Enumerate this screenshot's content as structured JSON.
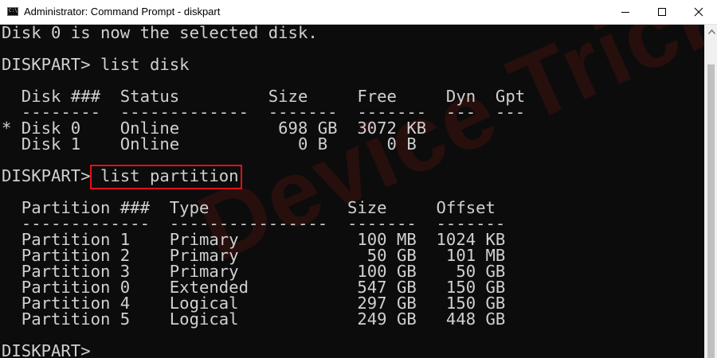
{
  "window": {
    "title": "Administrator: Command Prompt - diskpart",
    "icon_text": "C:\\",
    "icons": {
      "app": "command-prompt-icon",
      "minimize": "minimize-icon",
      "maximize": "maximize-icon",
      "close": "close-icon",
      "scroll_up": "scroll-up-arrow-icon"
    }
  },
  "console": {
    "lines": [
      "Disk 0 is now the selected disk.",
      "",
      "DISKPART> list disk",
      "",
      "  Disk ###  Status         Size     Free     Dyn  Gpt",
      "  --------  -------------  -------  -------  ---  ---",
      "* Disk 0    Online          698 GB  3072 KB",
      "  Disk 1    Online            0 B      0 B",
      "",
      "DISKPART> list partition",
      "",
      "  Partition ###  Type              Size     Offset",
      "  -------------  ----------------  -------  -------",
      "  Partition 1    Primary            100 MB  1024 KB",
      "  Partition 2    Primary             50 GB   101 MB",
      "  Partition 3    Primary            100 GB    50 GB",
      "  Partition 0    Extended           547 GB   150 GB",
      "  Partition 4    Logical            297 GB   150 GB",
      "  Partition 5    Logical            249 GB   448 GB",
      "",
      "DISKPART>"
    ],
    "highlighted_command": "list partition",
    "highlight_color": "#e0101a",
    "text_color": "#d0d0d0",
    "background_color": "#0c0c0c"
  },
  "watermark": {
    "text": "Device Tricks"
  }
}
